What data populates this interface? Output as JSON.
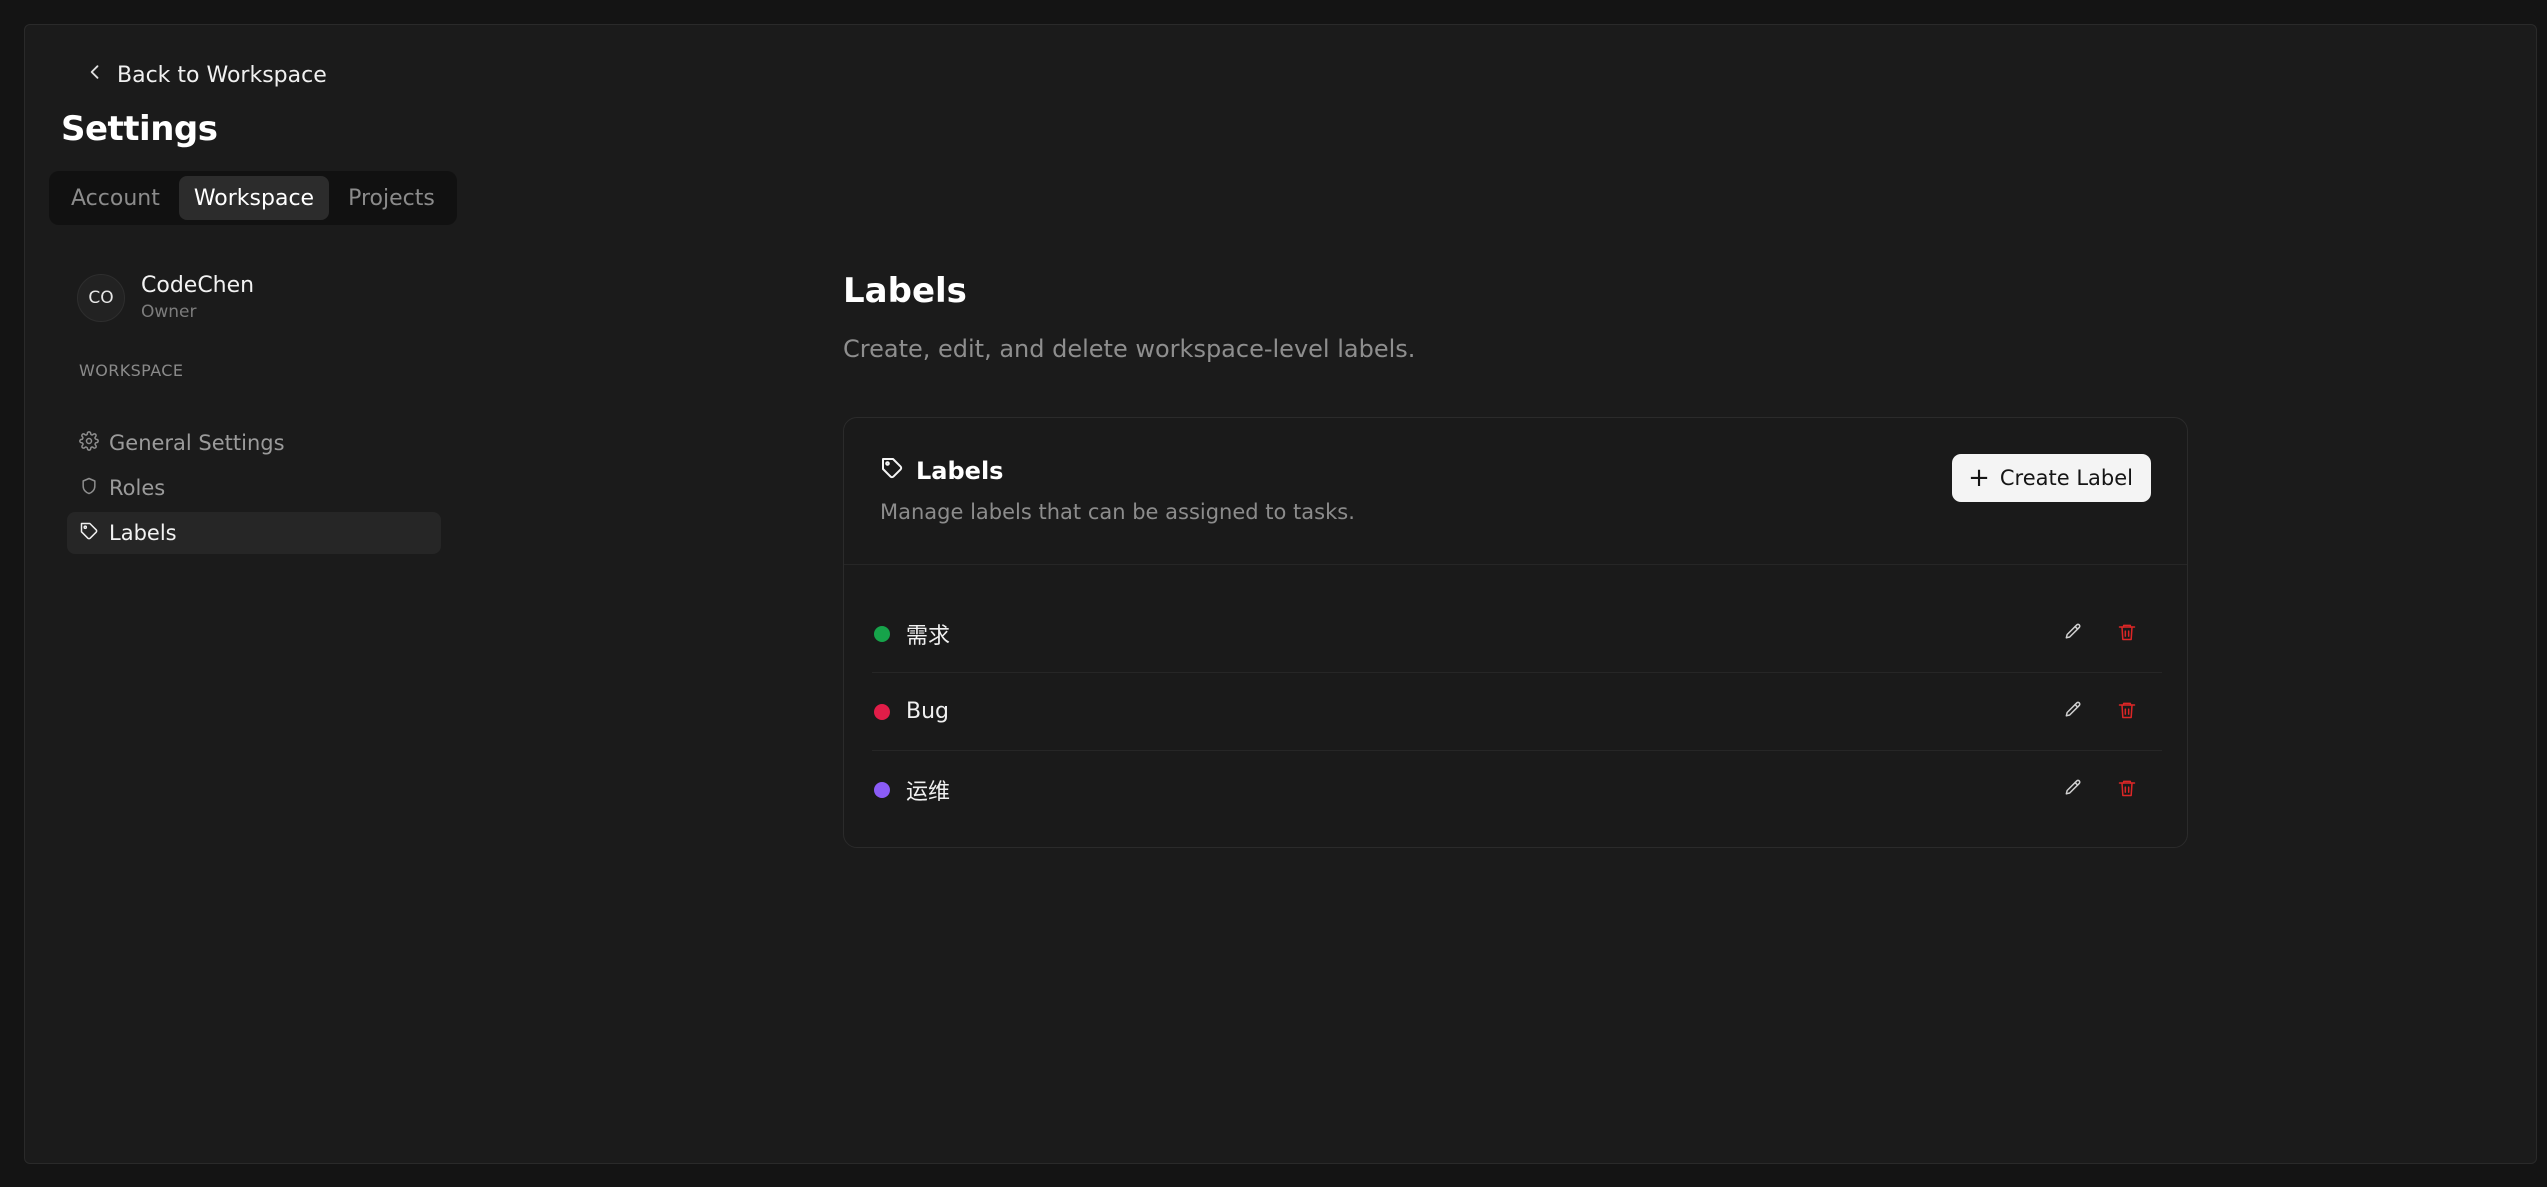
{
  "back": {
    "label": "Back to Workspace"
  },
  "settings": {
    "title": "Settings"
  },
  "tabs": [
    {
      "label": "Account",
      "active": false
    },
    {
      "label": "Workspace",
      "active": true
    },
    {
      "label": "Projects",
      "active": false
    }
  ],
  "user": {
    "initials": "CO",
    "name": "CodeChen",
    "role": "Owner"
  },
  "sidebar": {
    "section": "WORKSPACE",
    "items": [
      {
        "label": "General Settings",
        "icon": "gear-icon",
        "active": false
      },
      {
        "label": "Roles",
        "icon": "shield-icon",
        "active": false
      },
      {
        "label": "Labels",
        "icon": "tag-icon",
        "active": true
      }
    ]
  },
  "main": {
    "title": "Labels",
    "description": "Create, edit, and delete workspace-level labels."
  },
  "card": {
    "title": "Labels",
    "subtitle": "Manage labels that can be assigned to tasks.",
    "create_label": "Create Label"
  },
  "labels": [
    {
      "name": "需求",
      "color": "#16a34a"
    },
    {
      "name": "Bug",
      "color": "#e11d48"
    },
    {
      "name": "运维",
      "color": "#8b5cf6"
    }
  ],
  "colors": {
    "danger": "#dc2626",
    "accent": "#f4f4f4"
  }
}
